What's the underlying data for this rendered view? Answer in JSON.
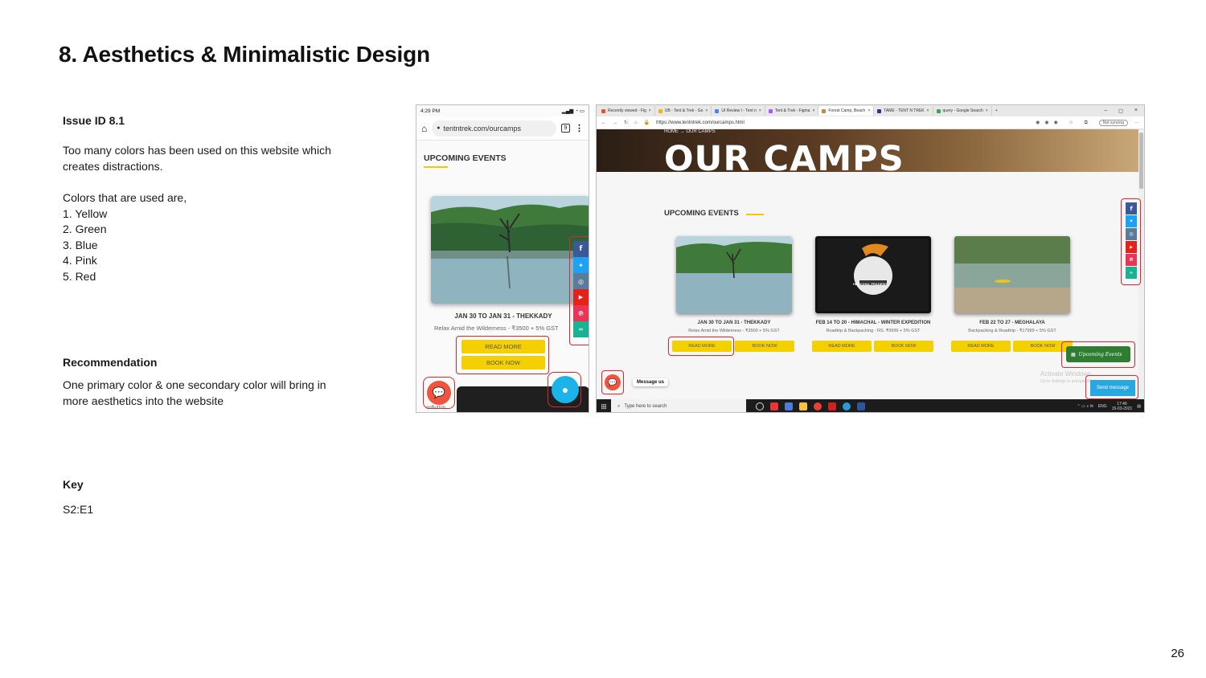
{
  "slide": {
    "title": "8. Aesthetics & Minimalistic Design",
    "issue_label": "Issue ID 8.1",
    "issue_text": "Too many colors has been used on this website which creates distractions.",
    "colors_intro": "Colors that are used are,",
    "colors": [
      "1. Yellow",
      "2. Green",
      "3. Blue",
      "4. Pink",
      "5. Red"
    ],
    "recommendation_label": "Recommendation",
    "recommendation_text": "One primary color & one secondary color will bring in more aesthetics into the website",
    "key_label": "Key",
    "key_value": "S2:E1",
    "page_number": "26"
  },
  "phone": {
    "time": "4:29 PM",
    "url": "tentntrek.com/ourcamps",
    "tab_count": "9",
    "heading": "UPCOMING EVENTS",
    "event_title": "JAN 30 TO JAN 31 - THEKKADY",
    "event_desc": "Relax Amid the Wilderness - ₹3500 + 5% GST",
    "read_more": "READ MORE",
    "book_now": "BOOK NOW",
    "button_caption": "onButton"
  },
  "desktop": {
    "tabs": [
      "Recently viewed - Fig",
      "UB - Tent & Trek - Go",
      "UI Review I - Tent n",
      "Tent & Trek - Figma",
      "Forest Camp, Beach",
      "TAME - TENT N TREK",
      "query - Google Search"
    ],
    "address": "https://www.tentntrek.com/ourcamps.html",
    "sync_label": "Not syncing",
    "breadcrumb": "HOME  →  OUR CAMPS",
    "hero_title": "OUR CAMPS",
    "heading": "UPCOMING EVENTS",
    "cards": [
      {
        "title": "JAN 30 TO JAN 31 - THEKKADY",
        "desc": "Relax Amid the Wilderness - ₹3500 + 5% GST"
      },
      {
        "title": "FEB 14 TO 20 - HIMACHAL - WINTER EXPEDITION",
        "desc": "Roadtrip & Backpacking - RS. ₹9999 + 5% GST"
      },
      {
        "title": "FEB 22 TO 27 - MEGHALAYA",
        "desc": "Backpacking & Roadtrip - ₹17999 + 5% GST"
      }
    ],
    "read_more": "READ MORE",
    "book_now": "BOOK NOW",
    "message_us": "Message us",
    "upcoming_badge": "Upcoming Events",
    "send_message": "Send message",
    "activate_title": "Activate Windows",
    "activate_sub": "Go to Settings to activate Windows.",
    "taskbar_search": "Type here to search",
    "lang": "ENG",
    "clock_time": "17:46",
    "clock_date": "15-03-2021",
    "himachal_badge": "HIMACHAL PRADESH"
  }
}
